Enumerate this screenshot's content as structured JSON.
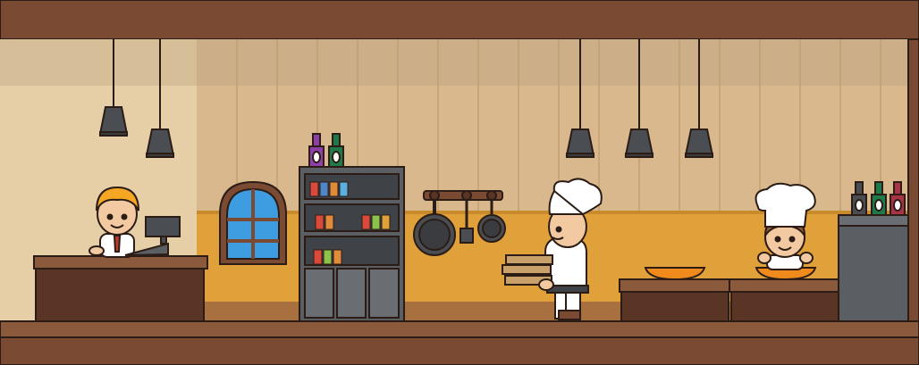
{
  "scene": {
    "name": "pizzeria-kitchen",
    "characters": [
      "cashier",
      "chef-carrying-pizza-boxes",
      "chef-cooking"
    ],
    "props": [
      "cash-register",
      "arched-window",
      "pantry-shelf",
      "hanging-pans",
      "pendant-lamps",
      "bottles",
      "pizza-pan"
    ]
  },
  "colors": {
    "frame": "#7a4a33",
    "wall_upper": "#e3c9a0",
    "wall_lower": "#e0a03a",
    "counter": "#5a3526",
    "metal": "#4a4d52",
    "outline": "#2b1d16"
  }
}
